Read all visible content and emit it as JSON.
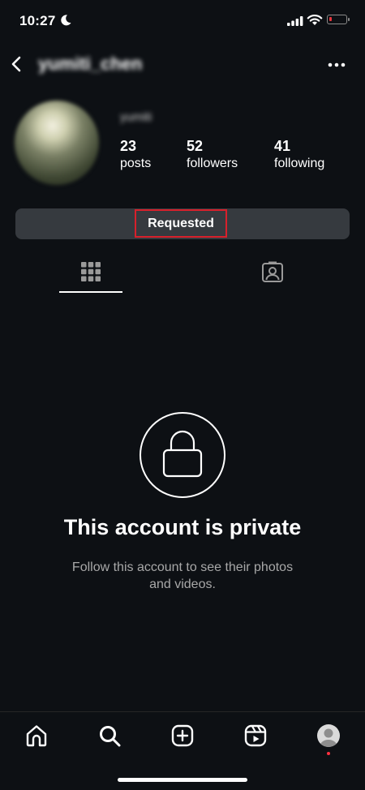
{
  "status_bar": {
    "time": "10:27"
  },
  "header": {
    "username": "yumiti_chen"
  },
  "profile": {
    "display_name": "yumiti",
    "stats": [
      {
        "value": "23",
        "label": "posts"
      },
      {
        "value": "52",
        "label": "followers"
      },
      {
        "value": "41",
        "label": "following"
      }
    ],
    "follow_button_label": "Requested"
  },
  "tabs": [
    "grid-icon",
    "tagged-icon"
  ],
  "private_notice": {
    "title": "This account is private",
    "subtitle_line1": "Follow this account to see their photos",
    "subtitle_line2": "and videos."
  },
  "bottom_nav": [
    "home-icon",
    "search-icon",
    "create-icon",
    "reels-icon",
    "profile-avatar"
  ],
  "colors": {
    "background": "#0d1014",
    "button": "#363a3f",
    "highlight_border": "#d8202b",
    "notification_dot": "#ff3040",
    "battery_low": "#e9343d"
  }
}
